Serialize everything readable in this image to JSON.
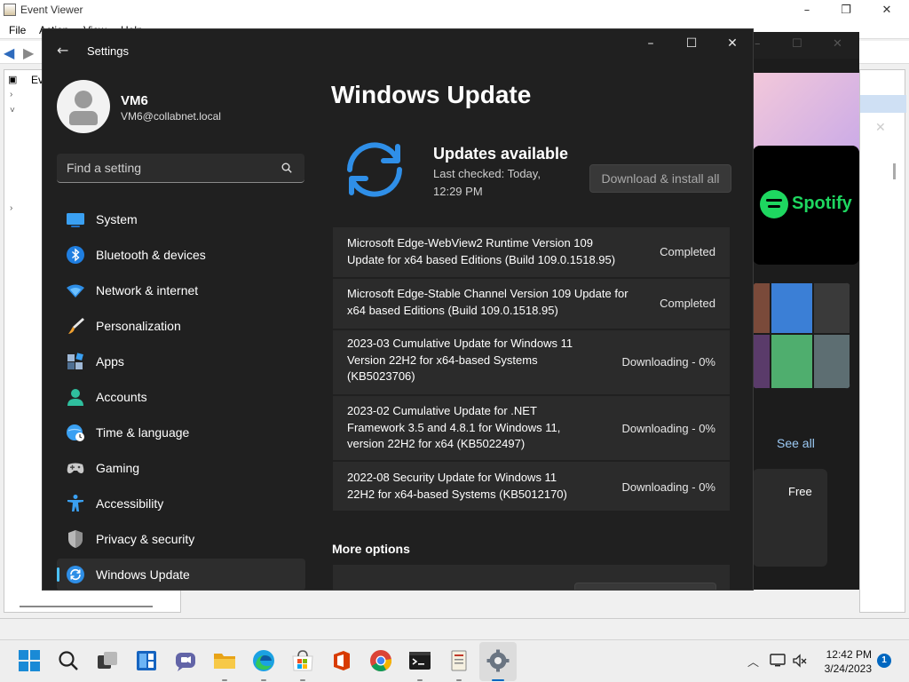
{
  "event_viewer": {
    "title": "Event Viewer",
    "menu": [
      "File",
      "Action",
      "View",
      "Help"
    ],
    "tree_root": "Eve"
  },
  "store": {
    "featured_app": "Spotify",
    "see_all": "See all",
    "price": "Free"
  },
  "settings": {
    "title": "Settings",
    "profile": {
      "name": "VM6",
      "email": "VM6@collabnet.local"
    },
    "search": {
      "placeholder": "Find a setting"
    },
    "nav": [
      {
        "label": "System",
        "icon": "system-icon"
      },
      {
        "label": "Bluetooth & devices",
        "icon": "bluetooth-icon"
      },
      {
        "label": "Network & internet",
        "icon": "wifi-icon"
      },
      {
        "label": "Personalization",
        "icon": "paintbrush-icon"
      },
      {
        "label": "Apps",
        "icon": "apps-icon"
      },
      {
        "label": "Accounts",
        "icon": "accounts-icon"
      },
      {
        "label": "Time & language",
        "icon": "globe-clock-icon"
      },
      {
        "label": "Gaming",
        "icon": "gamepad-icon"
      },
      {
        "label": "Accessibility",
        "icon": "accessibility-icon"
      },
      {
        "label": "Privacy & security",
        "icon": "shield-icon"
      },
      {
        "label": "Windows Update",
        "icon": "update-icon",
        "selected": true
      }
    ],
    "page": {
      "title": "Windows Update",
      "status_title": "Updates available",
      "last_checked": "Last checked: Today, 12:29 PM",
      "download_button": "Download & install all",
      "updates": [
        {
          "name": "Microsoft Edge-WebView2 Runtime Version 109 Update for x64 based Editions (Build 109.0.1518.95)",
          "status": "Completed"
        },
        {
          "name": "Microsoft Edge-Stable Channel Version 109 Update for x64 based Editions (Build 109.0.1518.95)",
          "status": "Completed"
        },
        {
          "name": "2023-03 Cumulative Update for Windows 11 Version 22H2 for x64-based Systems (KB5023706)",
          "status": "Downloading - 0%"
        },
        {
          "name": "2023-02 Cumulative Update for .NET Framework 3.5 and 4.8.1 for Windows 11, version 22H2 for x64 (KB5022497)",
          "status": "Downloading - 0%"
        },
        {
          "name": "2022-08 Security Update for Windows 11 22H2 for x64-based Systems (KB5012170)",
          "status": "Downloading - 0%"
        }
      ],
      "more_options": "More options"
    },
    "accent_color": "#4cc2ff"
  },
  "taskbar": {
    "apps": [
      "start-icon",
      "search-icon",
      "task-view-icon",
      "widgets-icon",
      "teams-chat-icon",
      "file-explorer-icon",
      "edge-icon",
      "microsoft-store-icon",
      "office-icon",
      "chrome-icon",
      "terminal-icon",
      "event-viewer-icon",
      "settings-icon"
    ],
    "time": "12:42 PM",
    "date": "3/24/2023",
    "notification_count": "1"
  }
}
